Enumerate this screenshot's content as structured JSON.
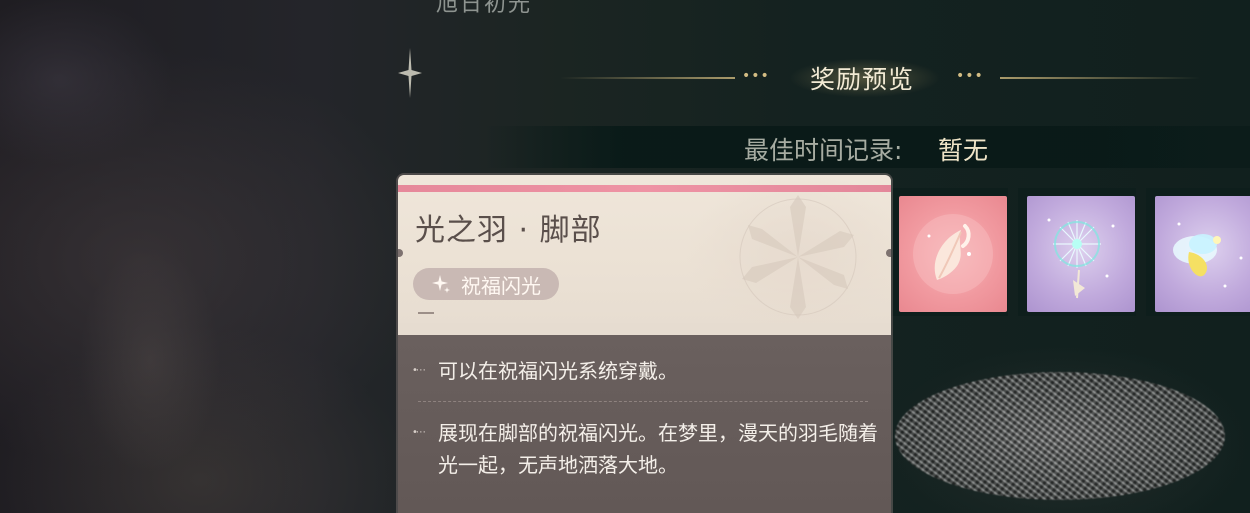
{
  "top_partial_text": "旭日初光",
  "reward_preview": {
    "title": "奖励预览",
    "deco_left": "•••",
    "deco_right": "•••"
  },
  "best_time": {
    "label": "最佳时间记录:",
    "value": "暂无"
  },
  "rewards": [
    {
      "icon": "feather-icon",
      "rarity_color": "#f19aa0"
    },
    {
      "icon": "dandelion-icon",
      "rarity_color": "#c0a9dc"
    },
    {
      "icon": "firefly-icon",
      "rarity_color": "#c0a9dc"
    }
  ],
  "item_card": {
    "title": "光之羽 · 脚部",
    "tag": "祝福闪光",
    "tag_icon": "sparkle-icon",
    "stripe_color": "#ee93a4",
    "descriptions": [
      "可以在祝福闪光系统穿戴。",
      "展现在脚部的祝福闪光。在梦里，漫天的羽毛随着光一起，无声地洒落大地。"
    ]
  }
}
